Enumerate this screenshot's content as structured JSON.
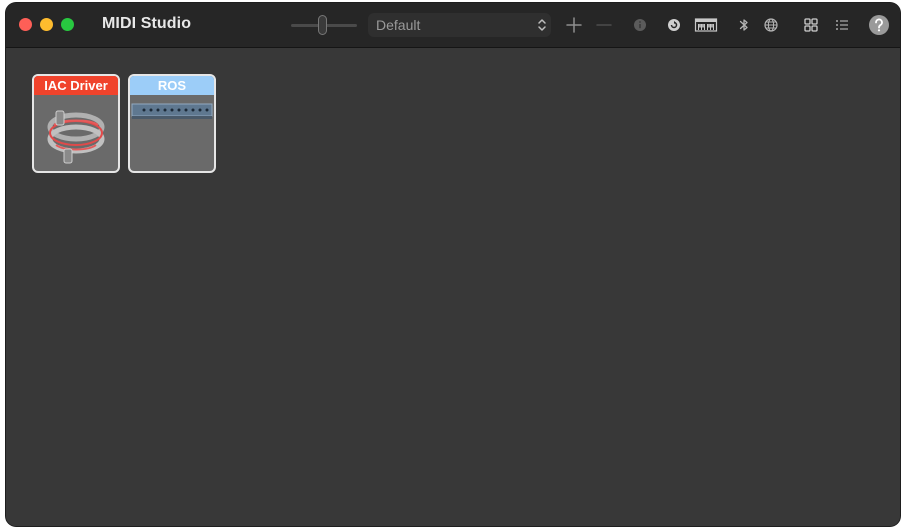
{
  "window": {
    "title": "MIDI Studio"
  },
  "toolbar": {
    "configuration": {
      "selected": "Default"
    },
    "icons": [
      "add-icon",
      "remove-icon",
      "info-icon",
      "rescan-icon",
      "keyboard-icon",
      "bluetooth-icon",
      "network-icon",
      "grid-view-icon",
      "list-view-icon",
      "help-icon"
    ]
  },
  "devices": [
    {
      "label": "IAC Driver",
      "color": "#f0432c"
    },
    {
      "label": "ROS",
      "color": "#9ccdf8"
    }
  ],
  "colors": {
    "background": "#383838",
    "titlebar": "#262626",
    "close": "#fe5f57",
    "minimize": "#febc2e",
    "maximize": "#28c840"
  }
}
